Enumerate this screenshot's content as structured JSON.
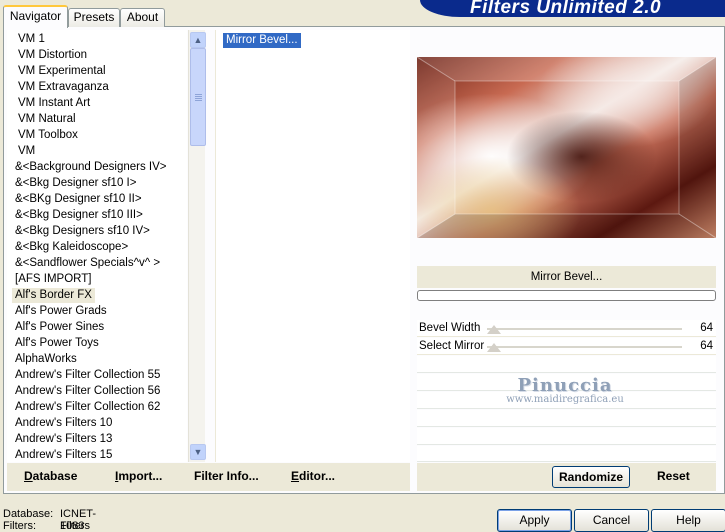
{
  "banner": {
    "title": "Filters Unlimited 2.0"
  },
  "tabs": [
    {
      "label": "Navigator",
      "active": true
    },
    {
      "label": "Presets",
      "active": false
    },
    {
      "label": "About",
      "active": false
    }
  ],
  "filter_list": {
    "items": [
      "VM 1",
      "VM Distortion",
      "VM Experimental",
      "VM Extravaganza",
      "VM Instant Art",
      "VM Natural",
      "VM Toolbox",
      "VM",
      "&<Background Designers IV>",
      "&<Bkg Designer sf10 I>",
      "&<BKg Designer sf10 II>",
      "&<Bkg Designer sf10 III>",
      "&<Bkg Designers sf10 IV>",
      "&<Bkg Kaleidoscope>",
      "&<Sandflower Specials^v^ >",
      "[AFS IMPORT]",
      "Alf's Border FX",
      "Alf's Power Grads",
      "Alf's Power Sines",
      "Alf's Power Toys",
      "AlphaWorks",
      "Andrew's Filter Collection 55",
      "Andrew's Filter Collection 56",
      "Andrew's Filter Collection 62",
      "Andrew's Filters 10",
      "Andrew's Filters 13",
      "Andrew's Filters 15"
    ],
    "selected_index": 16
  },
  "scrollbar": {
    "up_arrow": "▲",
    "down_arrow": "▼"
  },
  "effects": {
    "items": [
      "Mirror Bevel..."
    ]
  },
  "preview": {
    "filter_label": "Mirror Bevel..."
  },
  "parameters": [
    {
      "label": "Bevel Width",
      "value": "64",
      "level": 0.25
    },
    {
      "label": "Select Mirror",
      "value": "64",
      "level": 0.25
    }
  ],
  "watermark": {
    "name": "Pinuccia",
    "url": "www.maidiregrafica.eu"
  },
  "left_actions": [
    {
      "label": "Database",
      "ul": "D",
      "rest": "atabase"
    },
    {
      "label": "Import...",
      "ul": "I",
      "rest": "mport..."
    },
    {
      "label": "Filter Info...",
      "ul": "",
      "rest": "Filter Info..."
    },
    {
      "label": "Editor...",
      "ul": "E",
      "rest": "ditor..."
    }
  ],
  "right_actions": {
    "randomize": "Randomize",
    "reset": "Reset"
  },
  "footer": {
    "database_label": "Database:",
    "database_value": "ICNET-Filters",
    "filters_label": "Filters:",
    "filters_value": "1083"
  },
  "dialog_buttons": {
    "apply": "Apply",
    "cancel": "Cancel",
    "help": "Help"
  }
}
